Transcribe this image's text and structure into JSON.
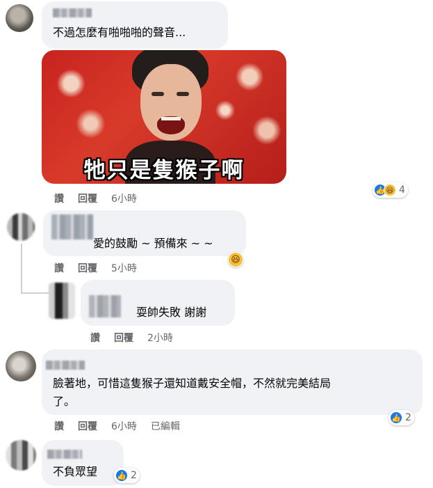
{
  "comments": [
    {
      "text": "不過怎麼有啪啪啪的聲音...",
      "image_caption": "牠只是隻猴子啊",
      "actions": [
        "讚",
        "回覆"
      ],
      "time": "6小時",
      "reaction_count": "4"
    },
    {
      "text": "愛的鼓勵 ~ 預備來 ~ ~",
      "actions": [
        "讚",
        "回覆"
      ],
      "time": "5小時"
    },
    {
      "text": "耍帥失敗 謝謝",
      "actions": [
        "讚",
        "回覆"
      ],
      "time": "2小時"
    },
    {
      "text_line1": "臉著地，可惜這隻猴子還知道戴安全帽，不然就完美結局",
      "text_line2": "了。",
      "actions": [
        "讚",
        "回覆"
      ],
      "time": "6小時",
      "edited": "已編輯",
      "reaction_count": "2"
    },
    {
      "text": "不負眾望",
      "reaction_count": "2"
    }
  ],
  "icons": {
    "like": "thumbs-up-icon",
    "haha": "laughing-face-icon"
  },
  "colors": {
    "bubble": "#f0f2f5",
    "like_blue": "#1877f2",
    "meta_gray": "#65676b"
  }
}
